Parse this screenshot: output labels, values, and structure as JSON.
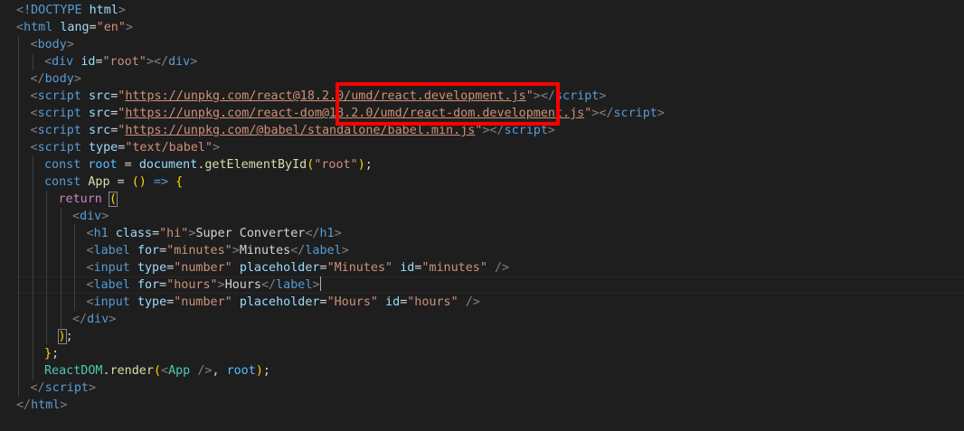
{
  "editor": {
    "language": "html",
    "lines": [
      {
        "indent": 0,
        "tokens": [
          [
            "t-bracket",
            "<"
          ],
          [
            "t-tag",
            "!DOCTYPE "
          ],
          [
            "t-attr",
            "html"
          ],
          [
            "t-bracket",
            ">"
          ]
        ]
      },
      {
        "indent": 0,
        "tokens": [
          [
            "t-bracket",
            "<"
          ],
          [
            "t-tag",
            "html "
          ],
          [
            "t-attr",
            "lang"
          ],
          [
            "t-op",
            "="
          ],
          [
            "t-str",
            "\"en\""
          ],
          [
            "t-bracket",
            ">"
          ]
        ]
      },
      {
        "indent": 1,
        "tokens": [
          [
            "t-bracket",
            "<"
          ],
          [
            "t-tag",
            "body"
          ],
          [
            "t-bracket",
            ">"
          ]
        ]
      },
      {
        "indent": 2,
        "tokens": [
          [
            "t-bracket",
            "<"
          ],
          [
            "t-tag",
            "div "
          ],
          [
            "t-attr",
            "id"
          ],
          [
            "t-op",
            "="
          ],
          [
            "t-str",
            "\"root\""
          ],
          [
            "t-bracket",
            "></"
          ],
          [
            "t-tag",
            "div"
          ],
          [
            "t-bracket",
            ">"
          ]
        ]
      },
      {
        "indent": 1,
        "tokens": [
          [
            "t-bracket",
            "</"
          ],
          [
            "t-tag",
            "body"
          ],
          [
            "t-bracket",
            ">"
          ]
        ]
      },
      {
        "indent": 1,
        "tokens": [
          [
            "t-bracket",
            "<"
          ],
          [
            "t-tag",
            "script "
          ],
          [
            "t-attr",
            "src"
          ],
          [
            "t-op",
            "="
          ],
          [
            "t-str",
            "\""
          ],
          [
            "t-url",
            "https://unpkg.com/react@18.2.0/umd/react.development.js"
          ],
          [
            "t-str",
            "\""
          ],
          [
            "t-bracket",
            "></"
          ],
          [
            "t-tag",
            "script"
          ],
          [
            "t-bracket",
            ">"
          ]
        ]
      },
      {
        "indent": 1,
        "tokens": [
          [
            "t-bracket",
            "<"
          ],
          [
            "t-tag",
            "script "
          ],
          [
            "t-attr",
            "src"
          ],
          [
            "t-op",
            "="
          ],
          [
            "t-str",
            "\""
          ],
          [
            "t-url",
            "https://unpkg.com/react-dom@18.2.0/umd/react-dom.development.js"
          ],
          [
            "t-str",
            "\""
          ],
          [
            "t-bracket",
            "></"
          ],
          [
            "t-tag",
            "script"
          ],
          [
            "t-bracket",
            ">"
          ]
        ]
      },
      {
        "indent": 1,
        "tokens": [
          [
            "t-bracket",
            "<"
          ],
          [
            "t-tag",
            "script "
          ],
          [
            "t-attr",
            "src"
          ],
          [
            "t-op",
            "="
          ],
          [
            "t-str",
            "\""
          ],
          [
            "t-url",
            "https://unpkg.com/@babel/standalone/babel.min.js"
          ],
          [
            "t-str",
            "\""
          ],
          [
            "t-bracket",
            "></"
          ],
          [
            "t-tag",
            "script"
          ],
          [
            "t-bracket",
            ">"
          ]
        ]
      },
      {
        "indent": 1,
        "tokens": [
          [
            "t-bracket",
            "<"
          ],
          [
            "t-tag",
            "script "
          ],
          [
            "t-attr",
            "type"
          ],
          [
            "t-op",
            "="
          ],
          [
            "t-str",
            "\"text/babel\""
          ],
          [
            "t-bracket",
            ">"
          ]
        ]
      },
      {
        "indent": 2,
        "tokens": [
          [
            "t-kw",
            "const "
          ],
          [
            "t-const",
            "root"
          ],
          [
            "t-op",
            " = "
          ],
          [
            "t-var",
            "document"
          ],
          [
            "t-op",
            "."
          ],
          [
            "t-fn",
            "getElementById"
          ],
          [
            "t-b1",
            "("
          ],
          [
            "t-str",
            "\"root\""
          ],
          [
            "t-b1",
            ")"
          ],
          [
            "t-op",
            ";"
          ]
        ]
      },
      {
        "indent": 2,
        "tokens": [
          [
            "t-kw",
            "const "
          ],
          [
            "t-fn",
            "App"
          ],
          [
            "t-op",
            " = "
          ],
          [
            "t-b1",
            "()"
          ],
          [
            "t-kw",
            " => "
          ],
          [
            "t-b1",
            "{"
          ]
        ]
      },
      {
        "indent": 3,
        "tokens": [
          [
            "t-ctrl",
            "return "
          ],
          [
            "t-match",
            "("
          ]
        ]
      },
      {
        "indent": 4,
        "tokens": [
          [
            "t-bracket",
            "<"
          ],
          [
            "t-tag",
            "div"
          ],
          [
            "t-bracket",
            ">"
          ]
        ]
      },
      {
        "indent": 5,
        "tokens": [
          [
            "t-bracket",
            "<"
          ],
          [
            "t-tag",
            "h1 "
          ],
          [
            "t-attr",
            "class"
          ],
          [
            "t-op",
            "="
          ],
          [
            "t-str",
            "\"hi\""
          ],
          [
            "t-bracket",
            ">"
          ],
          [
            "t-text",
            "Super Converter"
          ],
          [
            "t-bracket",
            "</"
          ],
          [
            "t-tag",
            "h1"
          ],
          [
            "t-bracket",
            ">"
          ]
        ]
      },
      {
        "indent": 5,
        "tokens": [
          [
            "t-bracket",
            "<"
          ],
          [
            "t-tag",
            "label "
          ],
          [
            "t-attr",
            "for"
          ],
          [
            "t-op",
            "="
          ],
          [
            "t-str",
            "\"minutes\""
          ],
          [
            "t-bracket",
            ">"
          ],
          [
            "t-text",
            "Minutes"
          ],
          [
            "t-bracket",
            "</"
          ],
          [
            "t-tag",
            "label"
          ],
          [
            "t-bracket",
            ">"
          ]
        ]
      },
      {
        "indent": 5,
        "tokens": [
          [
            "t-bracket",
            "<"
          ],
          [
            "t-tag",
            "input "
          ],
          [
            "t-attr",
            "type"
          ],
          [
            "t-op",
            "="
          ],
          [
            "t-str",
            "\"number\" "
          ],
          [
            "t-attr",
            "placeholder"
          ],
          [
            "t-op",
            "="
          ],
          [
            "t-str",
            "\"Minutes\" "
          ],
          [
            "t-attr",
            "id"
          ],
          [
            "t-op",
            "="
          ],
          [
            "t-str",
            "\"minutes\" "
          ],
          [
            "t-bracket",
            "/>"
          ]
        ]
      },
      {
        "indent": 5,
        "tokens": [
          [
            "t-bracket",
            "<"
          ],
          [
            "t-tag",
            "label "
          ],
          [
            "t-attr",
            "for"
          ],
          [
            "t-op",
            "="
          ],
          [
            "t-str",
            "\"hours\""
          ],
          [
            "t-bracket",
            ">"
          ],
          [
            "t-text",
            "Hours"
          ],
          [
            "t-bracket",
            "</"
          ],
          [
            "t-tag",
            "label"
          ],
          [
            "t-bracket",
            ">"
          ]
        ],
        "cursor": true
      },
      {
        "indent": 5,
        "tokens": [
          [
            "t-bracket",
            "<"
          ],
          [
            "t-tag",
            "input "
          ],
          [
            "t-attr",
            "type"
          ],
          [
            "t-op",
            "="
          ],
          [
            "t-str",
            "\"number\" "
          ],
          [
            "t-attr",
            "placeholder"
          ],
          [
            "t-op",
            "="
          ],
          [
            "t-str",
            "\"Hours\" "
          ],
          [
            "t-attr",
            "id"
          ],
          [
            "t-op",
            "="
          ],
          [
            "t-str",
            "\"hours\" "
          ],
          [
            "t-bracket",
            "/>"
          ]
        ]
      },
      {
        "indent": 4,
        "tokens": [
          [
            "t-bracket",
            "</"
          ],
          [
            "t-tag",
            "div"
          ],
          [
            "t-bracket",
            ">"
          ]
        ]
      },
      {
        "indent": 3,
        "tokens": [
          [
            "t-match",
            ")"
          ],
          [
            "t-op",
            ";"
          ]
        ]
      },
      {
        "indent": 2,
        "tokens": [
          [
            "t-b1",
            "}"
          ],
          [
            "t-op",
            ";"
          ]
        ]
      },
      {
        "indent": 2,
        "tokens": [
          [
            "t-comp",
            "ReactDOM"
          ],
          [
            "t-op",
            "."
          ],
          [
            "t-fn",
            "render"
          ],
          [
            "t-b1",
            "("
          ],
          [
            "t-bracket",
            "<"
          ],
          [
            "t-comp",
            "App "
          ],
          [
            "t-bracket",
            "/>"
          ],
          [
            "t-op",
            ", "
          ],
          [
            "t-const",
            "root"
          ],
          [
            "t-b1",
            ")"
          ],
          [
            "t-op",
            ";"
          ]
        ]
      },
      {
        "indent": 1,
        "tokens": [
          [
            "t-bracket",
            "</"
          ],
          [
            "t-tag",
            "script"
          ],
          [
            "t-bracket",
            ">"
          ]
        ]
      },
      {
        "indent": 0,
        "tokens": [
          [
            "t-bracket",
            "</"
          ],
          [
            "t-tag",
            "html"
          ],
          [
            "t-bracket",
            ">"
          ]
        ]
      }
    ]
  }
}
